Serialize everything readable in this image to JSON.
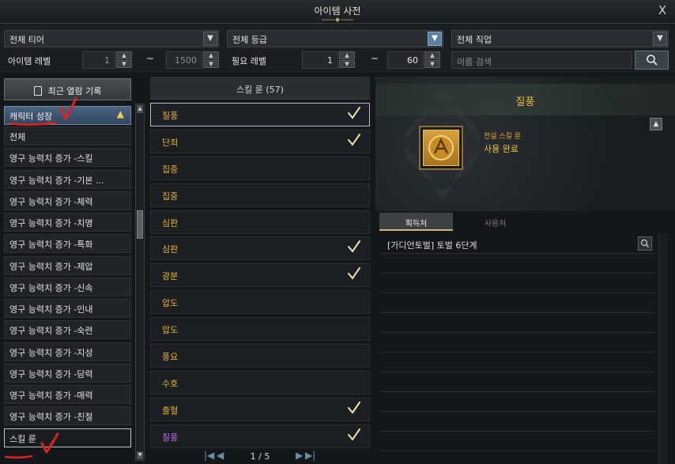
{
  "window": {
    "title": "아이템 사전",
    "close_label": "X"
  },
  "filters": {
    "tier": {
      "value": "전체 티어"
    },
    "grade": {
      "value": "전체 등급"
    },
    "class": {
      "value": "전체 직업"
    },
    "item_level": {
      "label": "아이템 레벨",
      "min": "1",
      "max": "1500"
    },
    "required_level": {
      "label": "필요 레벨",
      "min": "1",
      "max": "60"
    },
    "range_sep": "~",
    "search": {
      "placeholder": "이름 검색"
    }
  },
  "left_panel": {
    "recent_button": "최근 열람 기록",
    "category_header": "캐릭터 성장",
    "items": [
      {
        "label": "전체"
      },
      {
        "label": "영구 능력치 증가 -스킬"
      },
      {
        "label": "영구 능력치 증가 -기본 ..."
      },
      {
        "label": "영구 능력치 증가 -체력"
      },
      {
        "label": "영구 능력치 증가 -치명"
      },
      {
        "label": "영구 능력치 증가 -특화"
      },
      {
        "label": "영구 능력치 증가 -제압"
      },
      {
        "label": "영구 능력치 증가 -신속"
      },
      {
        "label": "영구 능력치 증가 -인내"
      },
      {
        "label": "영구 능력치 증가 -숙련"
      },
      {
        "label": "영구 능력치 증가 -지성"
      },
      {
        "label": "영구 능력치 증가 -담력"
      },
      {
        "label": "영구 능력치 증가 -매력"
      },
      {
        "label": "영구 능력치 증가 -친절"
      },
      {
        "label": "스킬 룬",
        "selected": true
      }
    ]
  },
  "middle_panel": {
    "header": "스킬 룬 (57)",
    "runes": [
      {
        "name": "질풍",
        "checked": true,
        "color": "gold",
        "selected": true
      },
      {
        "name": "단죄",
        "checked": true,
        "color": "gold"
      },
      {
        "name": "집중",
        "checked": false,
        "color": "gold"
      },
      {
        "name": "집중",
        "checked": false,
        "color": "gold"
      },
      {
        "name": "심판",
        "checked": false,
        "color": "gold"
      },
      {
        "name": "심판",
        "checked": true,
        "color": "gold"
      },
      {
        "name": "광분",
        "checked": true,
        "color": "gold"
      },
      {
        "name": "압도",
        "checked": false,
        "color": "gold"
      },
      {
        "name": "압도",
        "checked": false,
        "color": "gold"
      },
      {
        "name": "풍요",
        "checked": false,
        "color": "gold"
      },
      {
        "name": "수호",
        "checked": false,
        "color": "gold"
      },
      {
        "name": "출혈",
        "checked": true,
        "color": "gold"
      },
      {
        "name": "질풍",
        "checked": true,
        "color": "purple"
      }
    ],
    "pager": {
      "text": "1 / 5"
    }
  },
  "detail": {
    "title": "질풍",
    "grade": "전설 스킬 룬",
    "status": "사용 완료",
    "tabs": [
      "획득처",
      "사용처"
    ],
    "sources": [
      "[가디언토벌] 토벌 6단계"
    ]
  },
  "colors": {
    "accent_gold": "#e6b436",
    "legendary_purple": "#c36cf2",
    "selection_blue": "#4a6482",
    "annotation_red": "#e02020"
  }
}
